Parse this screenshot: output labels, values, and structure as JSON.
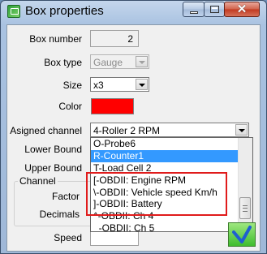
{
  "window": {
    "title": "Box properties"
  },
  "form": {
    "box_number": {
      "label": "Box number",
      "value": "2"
    },
    "box_type": {
      "label": "Box type",
      "value": "Gauge"
    },
    "size": {
      "label": "Size",
      "value": "x3"
    },
    "color": {
      "label": "Color",
      "value": "#ff0000"
    },
    "assigned_channel": {
      "label": "Asigned channel",
      "value": "4-Roller 2 RPM"
    },
    "lower_bound": {
      "label": "Lower Bound"
    },
    "upper_bound": {
      "label": "Upper Bound"
    },
    "channel_group": {
      "title": "Channel",
      "factor_label": "Factor",
      "decimals_label": "Decimals"
    },
    "speed": {
      "label": "Speed"
    }
  },
  "dropdown_list": {
    "items": [
      "O-Probe6",
      "R-Counter1",
      "T-Load Cell 2",
      "[-OBDII: Engine RPM",
      "\\-OBDII: Vehicle speed Km/h",
      "]-OBDII: Battery",
      "^-OBDII: Ch 4",
      "_-OBDII: Ch 5"
    ],
    "selected_index": 1
  },
  "colors": {
    "accent": "#3399ff",
    "highlight": "#e01b1b",
    "ok_green": "#3fbd2e"
  },
  "icons": {
    "ok_button": "green-checkmark-icon",
    "app_icon": "box-app-icon"
  }
}
